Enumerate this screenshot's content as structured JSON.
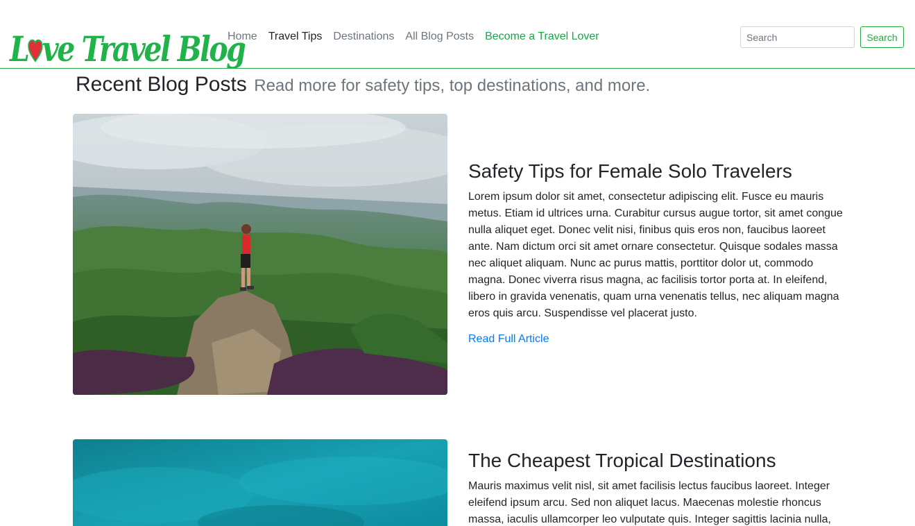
{
  "brand": {
    "name": "Love Travel Blog",
    "name_before_heart": "L",
    "name_after_heart": "ve Travel Blog"
  },
  "nav": {
    "items": [
      {
        "label": "Home",
        "state": "default"
      },
      {
        "label": "Travel Tips",
        "state": "active"
      },
      {
        "label": "Destinations",
        "state": "default"
      },
      {
        "label": "All Blog Posts",
        "state": "default"
      },
      {
        "label": "Become a Travel Lover",
        "state": "highlight"
      }
    ]
  },
  "search": {
    "placeholder": "Search",
    "button_label": "Search"
  },
  "heading": {
    "title": "Recent Blog Posts",
    "subtitle": "Read more for safety tips, top destinations, and more."
  },
  "posts": [
    {
      "title": "Safety Tips for Female Solo Travelers",
      "body": "Lorem ipsum dolor sit amet, consectetur adipiscing elit. Fusce eu mauris metus. Etiam id ultrices urna. Curabitur cursus augue tortor, sit amet congue nulla aliquet eget. Donec velit nisi, finibus quis eros non, faucibus laoreet ante. Nam dictum orci sit amet ornare consectetur. Quisque sodales massa nec aliquet aliquam. Nunc ac purus mattis, porttitor dolor ut, commodo magna. Donec viverra risus magna, ac facilisis tortor porta at. In eleifend, libero in gravida venenatis, quam urna venenatis tellus, nec aliquam magna eros quis arcu. Suspendisse vel placerat justo.",
      "link_label": "Read Full Article"
    },
    {
      "title": "The Cheapest Tropical Destinations",
      "body": "Mauris maximus velit nisl, sit amet facilisis lectus faucibus laoreet. Integer eleifend ipsum arcu. Sed non aliquet lacus. Maecenas molestie rhoncus massa, iaculis ullamcorper leo vulputate quis. Integer sagittis lacinia nulla,"
    }
  ],
  "colors": {
    "brand": "#1fb34a",
    "accent_green": "#28a745",
    "link_blue": "#007bff",
    "muted": "#6c757d",
    "heart": "#e0303a"
  }
}
